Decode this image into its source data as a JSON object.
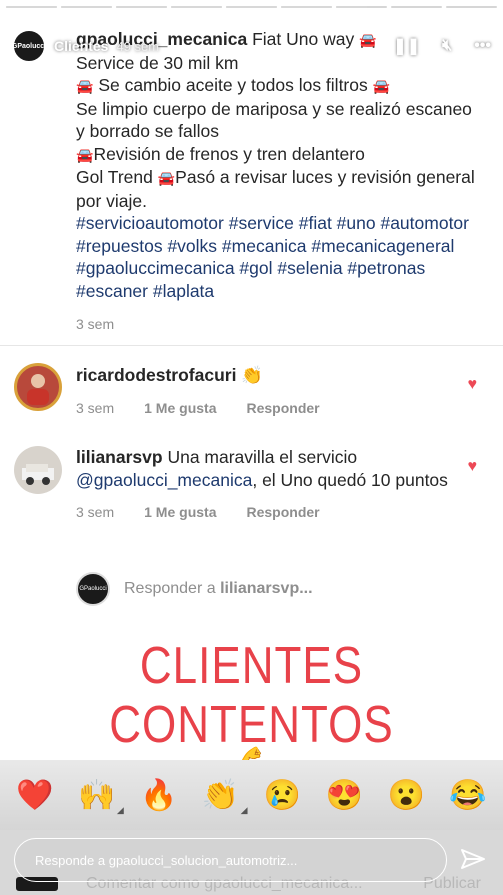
{
  "story": {
    "title": "Clientes",
    "time": "49 sem",
    "avatar_text": "GPaolucci",
    "progress": [
      1,
      1,
      1,
      1,
      1,
      1,
      0.6,
      0,
      0
    ]
  },
  "post": {
    "username": "gpaolucci_mecanica",
    "line1": "Fiat Uno way",
    "line2": "Service de 30 mil km",
    "line3": "Se cambio aceite y todos los filtros",
    "line4": "Se limpio cuerpo de mariposa y se realizó escaneo y borrado se fallos",
    "line5": "Revisión de frenos y tren delantero",
    "line6a": "Gol Trend",
    "line6b": "Pasó a revisar luces y revisión general por viaje.",
    "hashtags": "#servicioautomotor #service #fiat #uno #automotor #repuestos #volks #mecanica #mecanicageneral #gpaoluccimecanica #gol #selenia #petronas #escaner #laplata",
    "time": "3 sem"
  },
  "comments": [
    {
      "username": "ricardodestrofacuri",
      "emoji": "👏",
      "text": "",
      "mention": "",
      "text_after": "",
      "time": "3 sem",
      "likes": "1 Me gusta",
      "reply": "Responder"
    },
    {
      "username": "lilianarsvp",
      "emoji": "",
      "text": "Una maravilla el servicio",
      "mention": "@gpaolucci_mecanica",
      "text_after": ", el Uno quedó 10 puntos",
      "time": "3 sem",
      "likes": "1 Me gusta",
      "reply": "Responder"
    }
  ],
  "reply_input": {
    "prefix": "Responder a",
    "user": "lilianarsvp...",
    "avatar_text": "GPaolucci"
  },
  "banner": {
    "text": "CLIENTES CONTENTOS",
    "emoji": "💪"
  },
  "reactions": [
    "❤️",
    "🙌",
    "🔥",
    "👏",
    "😢",
    "😍",
    "😮",
    "😂"
  ],
  "message": {
    "placeholder": "Responde a gpaolucci_solucion_automotriz...",
    "ghost_left": "Comentar como gpaolucci_mecanica...",
    "ghost_right": "Publicar"
  },
  "colors": {
    "heart": "#ed4956",
    "hashtag": "#1e3a6e",
    "banner": "#e8424a"
  }
}
